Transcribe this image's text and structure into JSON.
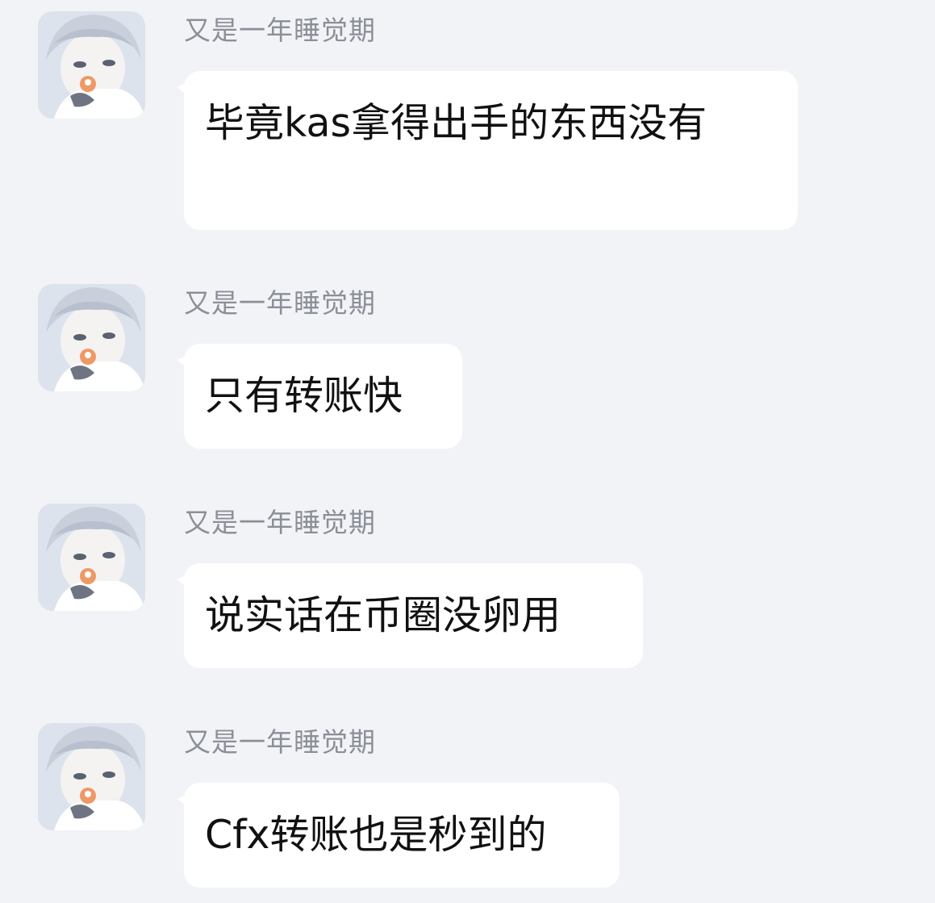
{
  "messages": [
    {
      "sender": "又是一年睡觉期",
      "text": "毕竟kas拿得出手的东西没有"
    },
    {
      "sender": "又是一年睡觉期",
      "text": "只有转账快"
    },
    {
      "sender": "又是一年睡觉期",
      "text": "说实话在币圈没卵用"
    },
    {
      "sender": "又是一年睡觉期",
      "text": "Cfx转账也是秒到的"
    }
  ]
}
